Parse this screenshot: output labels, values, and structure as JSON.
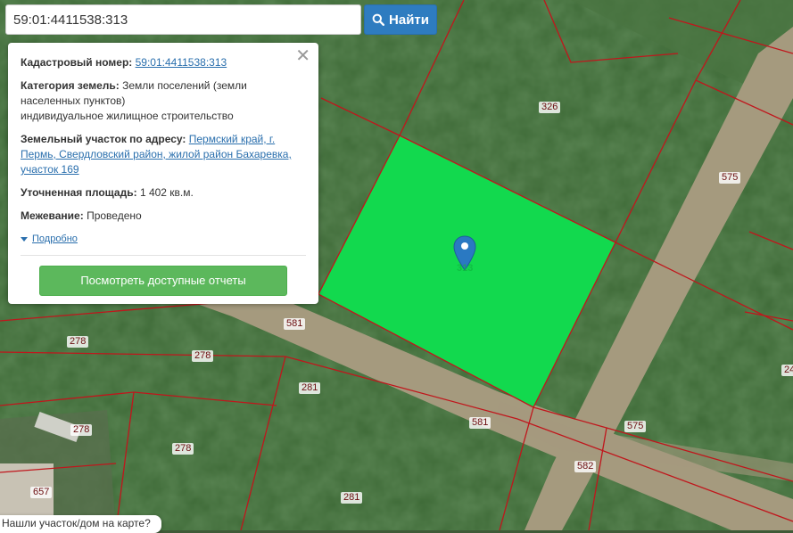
{
  "search": {
    "value": "59:01:4411538:313",
    "button_label": "Найти"
  },
  "info": {
    "cadastral_label": "Кадастровый номер:",
    "cadastral_number": "59:01:4411538:313",
    "category_label": "Категория земель:",
    "category_value": "Земли поселений (земли населенных пунктов)",
    "usage": "индивидуальное жилищное строительство",
    "address_label": "Земельный участок по адресу:",
    "address_value": "Пермский край, г. Пермь, Свердловский район, жилой район Бахаревка, участок 169",
    "area_label": "Уточненная площадь:",
    "area_value": "1 402 кв.м.",
    "survey_label": "Межевание:",
    "survey_value": "Проведено",
    "more_label": "Подробно",
    "report_button": "Посмотреть доступные отчеты"
  },
  "map": {
    "parcel_color": "#12d94e",
    "boundary_color": "#c0161c",
    "parcel_marker_label": "313",
    "plot_labels": [
      "326",
      "575",
      "581",
      "278",
      "278",
      "281",
      "581",
      "278",
      "575",
      "582",
      "278",
      "657",
      "281",
      "24"
    ]
  },
  "bottom_tip": "Нашли участок/дом на карте?"
}
